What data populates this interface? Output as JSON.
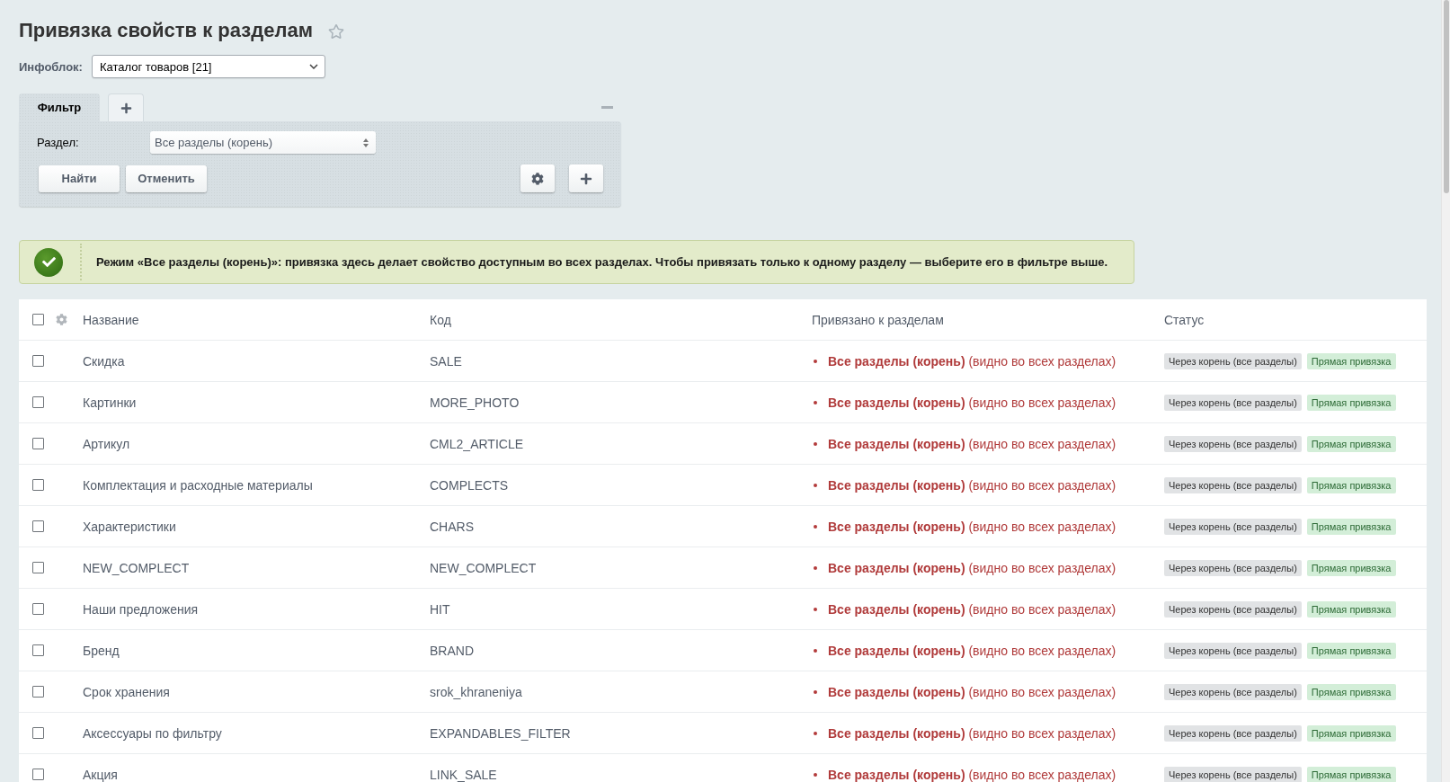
{
  "page": {
    "title": "Привязка свойств к разделам",
    "favorite": false
  },
  "iblock": {
    "label": "Инфоблок:",
    "value": "Каталог товаров [21]"
  },
  "filter": {
    "tabs": [
      {
        "label": "Фильтр",
        "selected": true
      }
    ],
    "fields": [
      {
        "label": "Раздел:",
        "value": "Все разделы (корень)"
      }
    ],
    "buttons": [
      "Найти",
      "Отменить"
    ]
  },
  "notice": {
    "kind": "success",
    "text": "Режим «Все разделы (корень)»: привязка здесь делает свойство доступным во всех разделах. Чтобы привязать только к одному разделу — выберите его в фильтре выше."
  },
  "table": {
    "all_checked": false,
    "columns": [
      "Название",
      "Код",
      "Привязано к разделам",
      "Статус"
    ],
    "rows": [
      {
        "checked": false,
        "name": "Скидка",
        "code": "SALE",
        "sections": "**Все разделы (корень)** (видно во всех разделах)",
        "tags": [
          {
            "label": "Через корень (все разделы)",
            "kind": "root"
          },
          {
            "label": "Прямая привязка",
            "kind": "direct"
          }
        ]
      },
      {
        "checked": false,
        "name": "Картинки",
        "code": "MORE_PHOTO",
        "sections": "**Все разделы (корень)** (видно во всех разделах)",
        "tags": [
          {
            "label": "Через корень (все разделы)",
            "kind": "root"
          },
          {
            "label": "Прямая привязка",
            "kind": "direct"
          }
        ]
      },
      {
        "checked": false,
        "name": "Артикул",
        "code": "CML2_ARTICLE",
        "sections": "**Все разделы (корень)** (видно во всех разделах)",
        "tags": [
          {
            "label": "Через корень (все разделы)",
            "kind": "root"
          },
          {
            "label": "Прямая привязка",
            "kind": "direct"
          }
        ]
      },
      {
        "checked": false,
        "name": "Комплектация и расходные материалы",
        "code": "COMPLECTS",
        "sections": "**Все разделы (корень)** (видно во всех разделах)",
        "tags": [
          {
            "label": "Через корень (все разделы)",
            "kind": "root"
          },
          {
            "label": "Прямая привязка",
            "kind": "direct"
          }
        ]
      },
      {
        "checked": false,
        "name": "Характеристики",
        "code": "CHARS",
        "sections": "**Все разделы (корень)** (видно во всех разделах)",
        "tags": [
          {
            "label": "Через корень (все разделы)",
            "kind": "root"
          },
          {
            "label": "Прямая привязка",
            "kind": "direct"
          }
        ]
      },
      {
        "checked": false,
        "name": "NEW_COMPLECT",
        "code": "NEW_COMPLECT",
        "sections": "**Все разделы (корень)** (видно во всех разделах)",
        "tags": [
          {
            "label": "Через корень (все разделы)",
            "kind": "root"
          },
          {
            "label": "Прямая привязка",
            "kind": "direct"
          }
        ]
      },
      {
        "checked": false,
        "name": "Наши предложения",
        "code": "HIT",
        "sections": "**Все разделы (корень)** (видно во всех разделах)",
        "tags": [
          {
            "label": "Через корень (все разделы)",
            "kind": "root"
          },
          {
            "label": "Прямая привязка",
            "kind": "direct"
          }
        ]
      },
      {
        "checked": false,
        "name": "Бренд",
        "code": "BRAND",
        "sections": "**Все разделы (корень)** (видно во всех разделах)",
        "tags": [
          {
            "label": "Через корень (все разделы)",
            "kind": "root"
          },
          {
            "label": "Прямая привязка",
            "kind": "direct"
          }
        ]
      },
      {
        "checked": false,
        "name": "Срок хранения",
        "code": "srok_khraneniya",
        "sections": "**Все разделы (корень)** (видно во всех разделах)",
        "tags": [
          {
            "label": "Через корень (все разделы)",
            "kind": "root"
          },
          {
            "label": "Прямая привязка",
            "kind": "direct"
          }
        ]
      },
      {
        "checked": false,
        "name": "Аксессуары по фильтру",
        "code": "EXPANDABLES_FILTER",
        "sections": "**Все разделы (корень)** (видно во всех разделах)",
        "tags": [
          {
            "label": "Через корень (все разделы)",
            "kind": "root"
          },
          {
            "label": "Прямая привязка",
            "kind": "direct"
          }
        ]
      },
      {
        "checked": false,
        "name": "Акция",
        "code": "LINK_SALE",
        "sections": "**Все разделы (корень)** (видно во всех разделах)",
        "tags": [
          {
            "label": "Через корень (все разделы)",
            "kind": "root"
          },
          {
            "label": "Прямая привязка",
            "kind": "direct"
          }
        ]
      }
    ]
  }
}
